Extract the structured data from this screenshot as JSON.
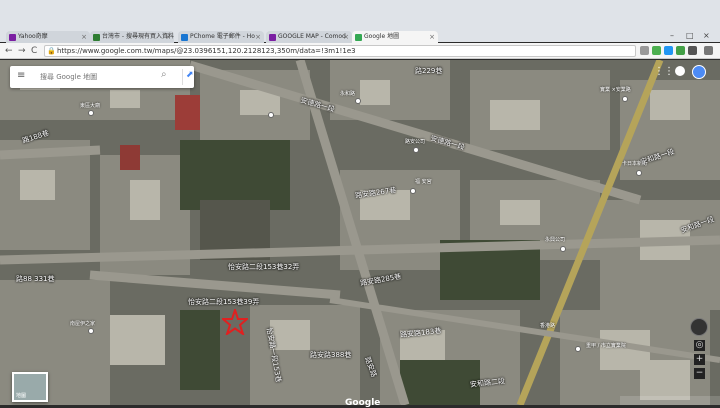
{
  "browser": {
    "tabs": [
      {
        "title": "Yahoo奇摩",
        "fav_color": "#7b1fa2",
        "active": false
      },
      {
        "title": "台灣市 - 搜尋現有買入資料",
        "fav_color": "#2e7d32",
        "active": false
      },
      {
        "title": "PChome 電子郵件 - Ho",
        "fav_color": "#1976d2",
        "active": false
      },
      {
        "title": "GOOGLE MAP - Comod",
        "fav_color": "#7b1fa2",
        "active": false
      },
      {
        "title": "Google 地圖",
        "fav_color": "#34a853",
        "active": true
      }
    ],
    "tab_close": "×",
    "window_controls": {
      "minimize": "–",
      "maximize": "□",
      "close": "×"
    },
    "nav": {
      "back": "←",
      "forward": "→",
      "reload": "C"
    },
    "url": "https://www.google.com.tw/maps/@23.0396151,120.2128123,350m/data=!3m1!1e3"
  },
  "maps": {
    "search_placeholder": "搜尋 Google 地圖",
    "menu_icon": "≡",
    "search_icon": "⌕",
    "directions_icon": "⬈",
    "apps_icon": "⋮⋮⋮",
    "earth_label": "地圖",
    "watermark": "Google",
    "zoom_in": "+",
    "zoom_out": "−",
    "road_labels": [
      "路229巷",
      "安德路一段",
      "安德路一段",
      "路188巷",
      "路安路267巷",
      "路安路285巷",
      "安和路一段",
      "安和路一段",
      "路88 331巷",
      "怡安路二段153巷32弄",
      "怡安路二段153巷39弄",
      "路安路388巷",
      "路安路183巷",
      "安和路二段",
      "怡安路一段153巷",
      "路安路"
    ],
    "pois": [
      "東區大廟",
      "永和路",
      "路安公司",
      "南屋伊之家",
      "福 安宮",
      "永興公司",
      "重甲 / 市立實業院",
      "卡日本新街",
      "實業 ×安業路",
      "香港路"
    ]
  }
}
